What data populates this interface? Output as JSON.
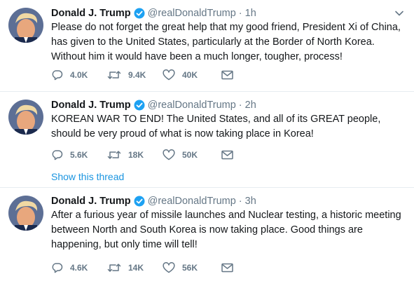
{
  "colors": {
    "link": "#1b95e0",
    "verified": "#1da1f2",
    "muted": "#657786",
    "text": "#14171a"
  },
  "tweets": [
    {
      "name": "Donald J. Trump",
      "handle": "@realDonaldTrump",
      "separator": "·",
      "time": "1h",
      "text": "Please do not forget the great help that my good friend, President Xi of China, has given to the United States, particularly at the Border of North Korea. Without him it would have been a much longer, tougher, process!",
      "replies": "4.0K",
      "retweets": "9.4K",
      "likes": "40K",
      "show_thread": ""
    },
    {
      "name": "Donald J. Trump",
      "handle": "@realDonaldTrump",
      "separator": "·",
      "time": "2h",
      "text": "KOREAN WAR TO END! The United States, and all of its GREAT people, should be very proud of what is now taking place in Korea!",
      "replies": "5.6K",
      "retweets": "18K",
      "likes": "50K",
      "show_thread": "Show this thread"
    },
    {
      "name": "Donald J. Trump",
      "handle": "@realDonaldTrump",
      "separator": "·",
      "time": "3h",
      "text": "After a furious year of missile launches and Nuclear testing, a historic meeting between North and South Korea is now taking place. Good things are happening, but only time will tell!",
      "replies": "4.6K",
      "retweets": "14K",
      "likes": "56K",
      "show_thread": ""
    }
  ],
  "icons": {
    "avatar": "profile-photo",
    "verified": "verified-badge-icon",
    "caret": "chevron-down-icon",
    "reply": "reply-bubble-icon",
    "retweet": "retweet-icon",
    "like": "heart-icon",
    "dm": "envelope-icon"
  }
}
